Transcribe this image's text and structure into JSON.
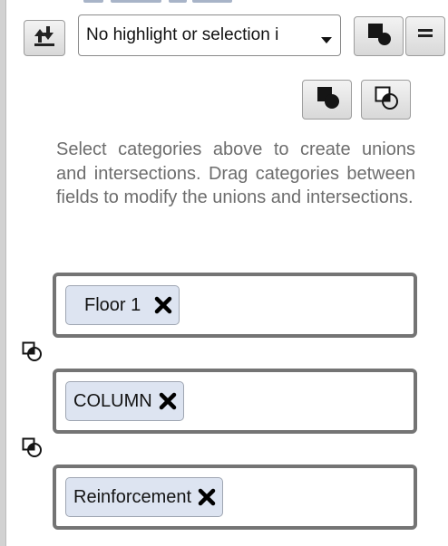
{
  "toolbar": {
    "download_icon": "download-arrows-icon",
    "highlight_mode_icon": "square-circle-icon",
    "menu_icon": "menu-lines-icon"
  },
  "highlight_select": {
    "value": "No highlight or selection i",
    "arrow_icon": "chevron-down-icon"
  },
  "operation_buttons": {
    "union_icon": "union-icon",
    "intersection_icon": "intersection-icon"
  },
  "instructions": "Select categories above to create unions and intersections. Drag categories between fields to modify the unions and intersections.",
  "fields": [
    {
      "chip_label": "Floor 1",
      "remove_icon": "close-icon"
    },
    {
      "chip_label": "COLUMN",
      "remove_icon": "close-icon"
    },
    {
      "chip_label": "Reinforcement",
      "remove_icon": "close-icon"
    }
  ],
  "operators_between_fields": [
    "intersection-icon",
    "intersection-icon"
  ],
  "colors": {
    "chip_background": "#dde4f1",
    "field_border": "#747474",
    "instruction_text": "#6d6d6d"
  }
}
